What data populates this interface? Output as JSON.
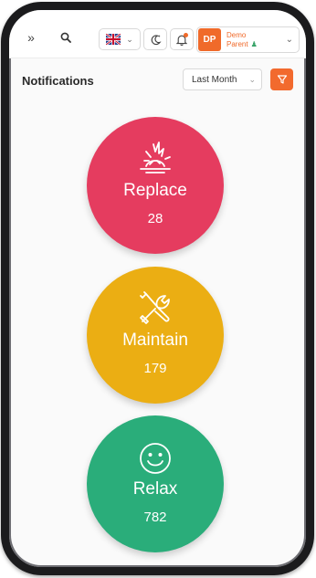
{
  "topbar": {
    "expand_glyph": "»",
    "icons": [
      "expand-icon",
      "search-icon",
      "uk-flag-icon",
      "theme-toggle-icon",
      "bell-icon",
      "user-check-icon"
    ],
    "user": {
      "initials": "DP",
      "name_line1": "Demo",
      "name_line2": "Parent"
    }
  },
  "page": {
    "title": "Notifications",
    "period": "Last Month"
  },
  "colors": {
    "accent": "#f06a2a",
    "replace": "#e53c5f",
    "maintain": "#ebae13",
    "relax": "#2aad7a"
  },
  "cards": [
    {
      "label": "Replace",
      "count": "28",
      "icon": "explosion-icon"
    },
    {
      "label": "Maintain",
      "count": "179",
      "icon": "tools-icon"
    },
    {
      "label": "Relax",
      "count": "782",
      "icon": "smiley-icon"
    }
  ]
}
